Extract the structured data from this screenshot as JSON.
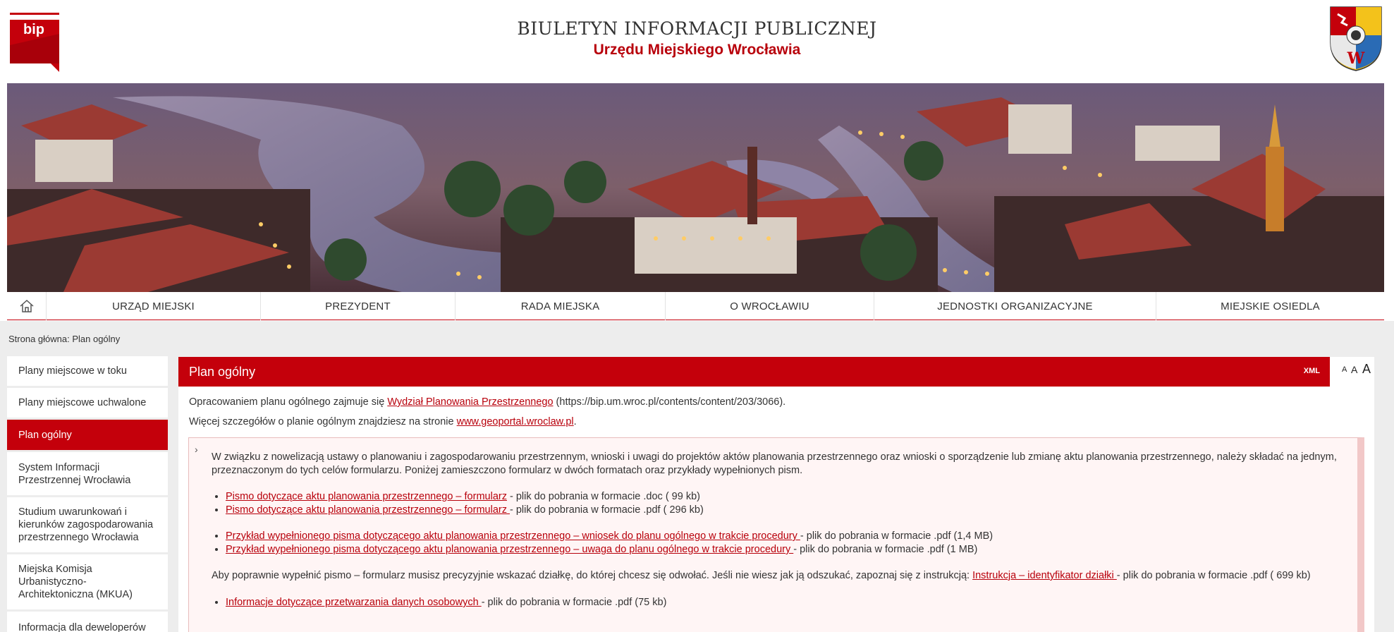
{
  "header": {
    "logo_text": "bip",
    "title": "BIULETYN INFORMACJI PUBLICZNEJ",
    "subtitle": "Urzędu Miejskiego Wrocławia"
  },
  "nav": {
    "items": [
      {
        "label": "URZĄD MIEJSKI"
      },
      {
        "label": "PREZYDENT"
      },
      {
        "label": "RADA MIEJSKA"
      },
      {
        "label": "O WROCŁAWIU"
      },
      {
        "label": "JEDNOSTKI ORGANIZACYJNE"
      },
      {
        "label": "MIEJSKIE OSIEDLA"
      }
    ]
  },
  "breadcrumb": "Strona główna: Plan ogólny",
  "sidebar": {
    "items": [
      {
        "label": "Plany miejscowe w toku",
        "active": false
      },
      {
        "label": "Plany miejscowe uchwalone",
        "active": false
      },
      {
        "label": "Plan ogólny",
        "active": true
      },
      {
        "label": "System Informacji Przestrzennej Wrocławia",
        "active": false
      },
      {
        "label": "Studium uwarunkowań i kierunków zagospodarowania przestrzennego Wrocławia",
        "active": false
      },
      {
        "label": "Miejska Komisja Urbanistyczno-Architektoniczna (MKUA)",
        "active": false
      },
      {
        "label": "Informacja dla deweloperów",
        "active": false
      }
    ]
  },
  "content": {
    "title": "Plan ogólny",
    "xml_label": "XML",
    "font_sizes": [
      "A",
      "A",
      "A"
    ],
    "intro1": {
      "prefix": "Opracowaniem planu ogólnego zajmuje się ",
      "link": "Wydział Planowania Przestrzennego",
      "suffix": " (https://bip.um.wroc.pl/contents/content/203/3066)."
    },
    "intro2": {
      "prefix": "Więcej szczegółów o planie ogólnym znajdziesz na stronie ",
      "link": "www.geoportal.wroclaw.pl",
      "suffix": "."
    },
    "notice": {
      "chevron": "›",
      "paragraph": "W związku z nowelizacją ustawy o planowaniu i zagospodarowaniu przestrzennym, wnioski i uwagi do projektów aktów planowania przestrzennego oraz wnioski o sporządzenie lub zmianę aktu planowania przestrzennego, należy składać na jednym, przeznaczonym do tych celów formularzu. Poniżej zamieszczono formularz w dwóch formatach oraz przykłady wypełnionych pism.",
      "forms": [
        {
          "link": "Pismo dotyczące aktu planowania przestrzennego – formularz",
          "desc": " - plik do pobrania w formacie .doc ( 99 kb)"
        },
        {
          "link": "Pismo dotyczące aktu planowania przestrzennego – formularz ",
          "desc": "- plik do pobrania w formacie .pdf ( 296 kb)"
        }
      ],
      "examples": [
        {
          "link": "Przykład wypełnionego pisma dotyczącego aktu planowania przestrzennego – wniosek do planu ogólnego w trakcie procedury ",
          "desc": " - plik do pobrania w formacie .pdf (1,4 MB)"
        },
        {
          "link": "Przykład wypełnionego pisma dotyczącego aktu planowania przestrzennego – uwaga do planu ogólnego w trakcie procedury ",
          "desc": "- plik do pobrania w formacie .pdf (1 MB)"
        }
      ],
      "instruction": {
        "prefix": "Aby poprawnie wypełnić pismo – formularz musisz precyzyjnie wskazać działkę, do której chcesz się odwołać. Jeśli nie wiesz jak ją odszukać, zapoznaj się z  instrukcją: ",
        "link": "Instrukcja – identyfikator działki ",
        "suffix": "- plik do pobrania w formacie .pdf ( 699 kb)"
      },
      "data_info": {
        "link": "Informacje dotyczące przetwarzania danych osobowych ",
        "desc": "- plik do pobrania w formacie .pdf (75 kb)"
      }
    }
  },
  "colors": {
    "brand_red": "#c4000b",
    "link_red": "#b8000b",
    "notice_bg": "#fff5f5"
  }
}
